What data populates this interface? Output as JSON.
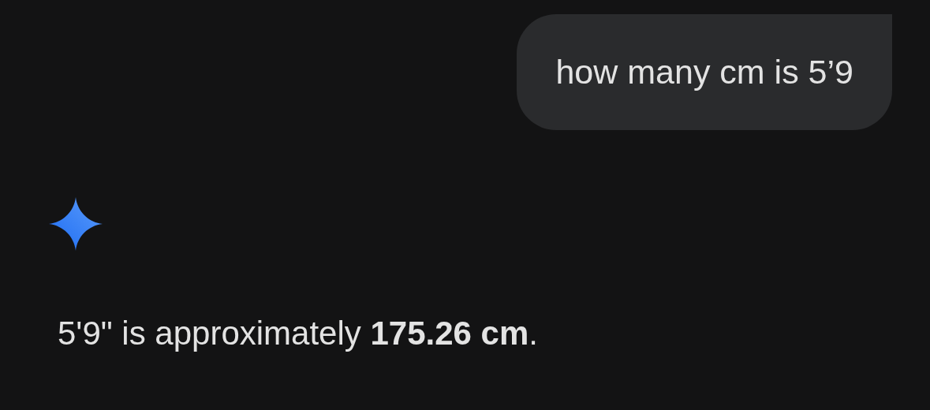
{
  "messages": [
    {
      "kind": "user",
      "text": "how many cm is 5’9"
    },
    {
      "kind": "assistant",
      "text": "5'9\" is approximately **175.26 cm**."
    }
  ]
}
